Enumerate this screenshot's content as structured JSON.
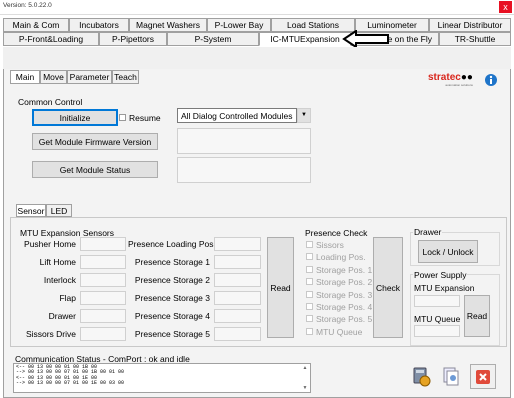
{
  "window": {
    "version": "Version: 5.0.22.0",
    "close": "x"
  },
  "tabs_row1": [
    "Main & Com",
    "Incubators",
    "Magnet Washers",
    "P-Lower Bay",
    "Load Stations",
    "Luminometer",
    "Linear Distributor"
  ],
  "tabs_row2": [
    "P-Front&Loading",
    "P-Pipettors",
    "P-System",
    "IC-MTUExpansion",
    "ate on the Fly",
    "TR-Shuttle"
  ],
  "subtabs": [
    "Main",
    "Move",
    "Parameter",
    "Teach"
  ],
  "logo": {
    "text_pre": "stra",
    "text_accent": "tec",
    "tagline": "automation solutions"
  },
  "common_control": {
    "title": "Common Control",
    "initialize": "Initialize",
    "resume": "Resume",
    "dropdown_value": "All Dialog Controlled Modules",
    "firmware_btn": "Get Module Firmware Version",
    "status_btn": "Get Module Status"
  },
  "subtabs2": [
    "Sensor",
    "LED"
  ],
  "mtu_sensors": {
    "title": "MTU Expansion Sensors",
    "left": [
      "Pusher Home",
      "Lift Home",
      "Interlock",
      "Flap",
      "Drawer",
      "Sissors Drive"
    ],
    "right": [
      "Presence Loading Pos.",
      "Presence Storage 1",
      "Presence Storage 2",
      "Presence Storage 3",
      "Presence Storage 4",
      "Presence Storage 5"
    ],
    "read": "Read"
  },
  "presence_check": {
    "title": "Presence Check",
    "items": [
      "Sissors",
      "Loading Pos.",
      "Storage Pos. 1",
      "Storage Pos. 2",
      "Storage Pos. 3",
      "Storage Pos. 4",
      "Storage Pos. 5",
      "MTU Queue"
    ],
    "check": "Check"
  },
  "drawer": {
    "title": "Drawer",
    "lock_unlock": "Lock / Unlock"
  },
  "power_supply": {
    "title": "Power Supply",
    "mtu_expansion": "MTU Expansion",
    "mtu_queue": "MTU Queue",
    "read": "Read"
  },
  "comm": {
    "title": "Communication Status - ComPort : ok and idle",
    "lines": [
      "<-- 00 13 00 00 01 00 1B 00",
      "--> 00 13 00 00 07 01 00 1B 00 01 00",
      "<-- 00 13 00 00 01 00 1E 00",
      "--> 00 13 00 00 07 01 00 1E 00 03 00"
    ]
  },
  "colors": {
    "accent": "#0078d7",
    "logo_red": "#d9261c",
    "close_red": "#e81123"
  }
}
